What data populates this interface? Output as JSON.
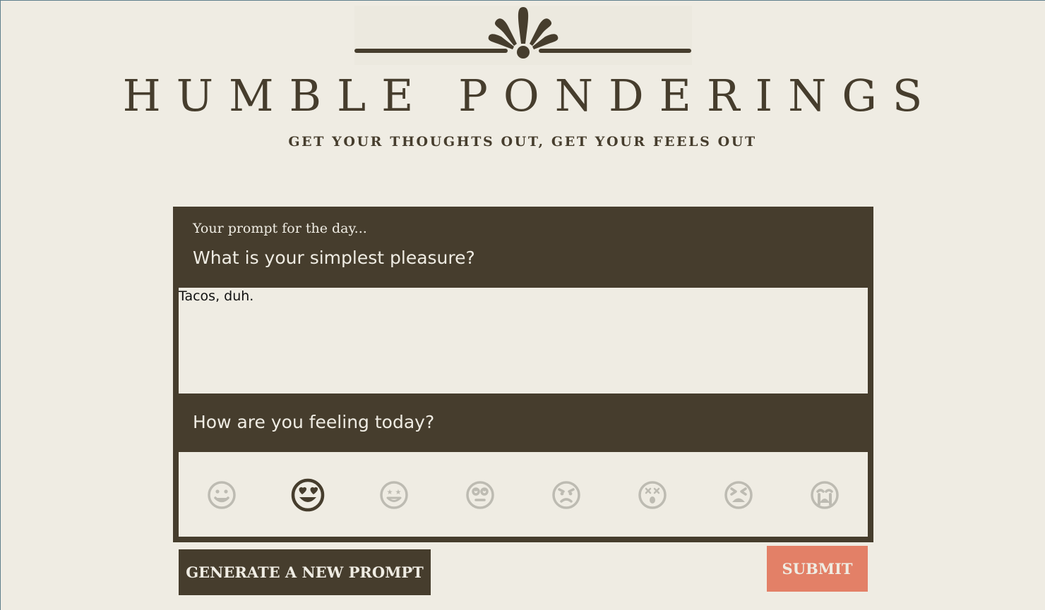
{
  "header": {
    "title": "HUMBLE PONDERINGS",
    "tagline": "GET YOUR THOUGHTS OUT, GET YOUR FEELS OUT"
  },
  "prompt": {
    "caption": "Your prompt for the day...",
    "question": "What is your simplest pleasure?",
    "answer": "Tacos, duh."
  },
  "feeling": {
    "question": "How are you feeling today?",
    "moods": [
      {
        "icon": "grinning-face-icon",
        "selected": false
      },
      {
        "icon": "heart-eyes-face-icon",
        "selected": true
      },
      {
        "icon": "star-struck-face-icon",
        "selected": false
      },
      {
        "icon": "eye-roll-face-icon",
        "selected": false
      },
      {
        "icon": "angry-face-icon",
        "selected": false
      },
      {
        "icon": "dizzy-face-icon",
        "selected": false
      },
      {
        "icon": "tired-face-icon",
        "selected": false
      },
      {
        "icon": "crying-face-icon",
        "selected": false
      }
    ]
  },
  "actions": {
    "generate_label": "GENERATE A NEW PROMPT",
    "submit_label": "SUBMIT"
  },
  "colors": {
    "dark": "#463d2d",
    "cream": "#efece3",
    "accent": "#e38067",
    "muted_icon": "#bdbbb2",
    "frame": "#5f7f8c"
  }
}
